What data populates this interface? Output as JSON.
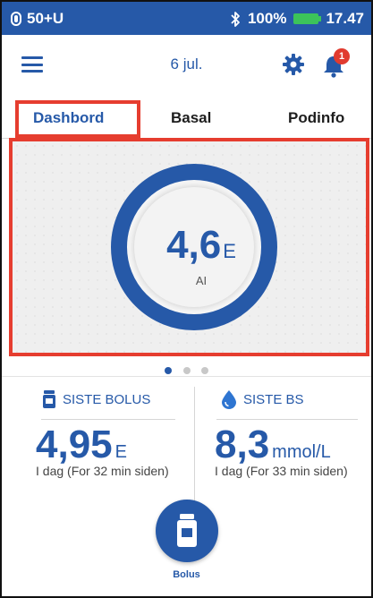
{
  "status_bar": {
    "pod_status": "50+U",
    "battery_percent": "100%",
    "time": "17.47",
    "icons": [
      "pod-icon",
      "bluetooth-icon",
      "battery-icon"
    ]
  },
  "header": {
    "date": "6 jul.",
    "notification_count": "1",
    "icons": [
      "menu-icon",
      "gear-icon",
      "bell-icon"
    ]
  },
  "tabs": [
    {
      "label": "Dashbord",
      "active": true
    },
    {
      "label": "Basal",
      "active": false
    },
    {
      "label": "Podinfo",
      "active": false
    }
  ],
  "dashboard": {
    "iob_value": "4,6",
    "iob_unit": "E",
    "iob_label": "AI",
    "page_count": 3,
    "active_page": 1
  },
  "last_bolus": {
    "title": "SISTE BOLUS",
    "value": "4,95",
    "unit": "E",
    "subtext": "I dag (For 32 min siden)"
  },
  "last_bg": {
    "title": "SISTE BS",
    "value": "8,3",
    "unit": "mmol/L",
    "subtext": "I dag (For 33 min siden)"
  },
  "bolus_button": {
    "label": "Bolus"
  },
  "colors": {
    "brand_blue": "#2659a8",
    "highlight_red": "#e63d2f",
    "battery_green": "#3cc35a",
    "badge_red": "#e13b2f"
  }
}
